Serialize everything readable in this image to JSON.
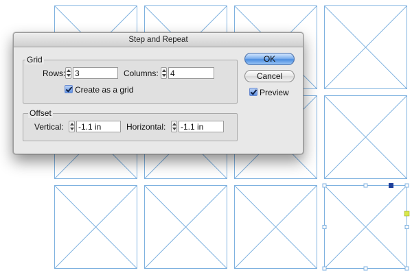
{
  "dialog": {
    "title": "Step and Repeat",
    "grid": {
      "label": "Grid",
      "rows_label": "Rows:",
      "rows_value": "3",
      "columns_label": "Columns:",
      "columns_value": "4",
      "create_grid_label": "Create as a grid",
      "create_grid_checked": true
    },
    "offset": {
      "label": "Offset",
      "vertical_label": "Vertical:",
      "vertical_value": "-1.1 in",
      "horizontal_label": "Horizontal:",
      "horizontal_value": "-1.1 in"
    },
    "ok_label": "OK",
    "cancel_label": "Cancel",
    "preview_label": "Preview",
    "preview_checked": true
  },
  "canvas": {
    "frame_stroke_color": "#7fb2e0",
    "selection_color": "#1d3f9a",
    "anchor_color": "#d9e84a",
    "rows": 3,
    "columns": 4,
    "selected_frame": {
      "row": 3,
      "column": 4
    }
  }
}
